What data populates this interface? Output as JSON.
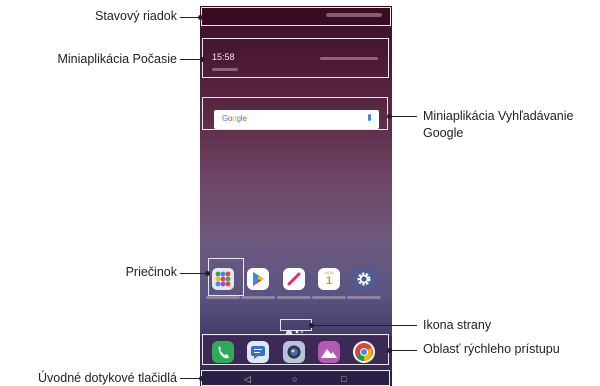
{
  "labels": {
    "status_bar": "Stavový riadok",
    "weather_widget": "Miniaplikácia Počasie",
    "google_search_line1": "Miniaplikácia Vyhľadávanie",
    "google_search_line2": "Google",
    "folder": "Priečinok",
    "page_icon": "Ikona strany",
    "quick_access": "Oblasť rýchleho prístupu",
    "home_touch_buttons": "Úvodné dotykové tlačidlá"
  },
  "phone": {
    "weather_time": "15:58",
    "google_logo": "Google",
    "nav_back": "◁",
    "nav_home": "○",
    "nav_recent": "□"
  },
  "colors": {
    "leader_line": "#222222",
    "highlight_box": "#e8e8ee",
    "wallpaper_top": "#3b0f26",
    "wallpaper_bottom": "#2a2449"
  },
  "icons": {
    "home_row": [
      "folder-icon",
      "play-store-icon",
      "quickmemo-icon",
      "calendar-icon",
      "settings-icon"
    ],
    "dock": [
      "phone-icon",
      "messages-icon",
      "camera-icon",
      "gallery-icon",
      "chrome-icon"
    ]
  },
  "calendar_icon": {
    "month": "MON",
    "day": "1"
  }
}
